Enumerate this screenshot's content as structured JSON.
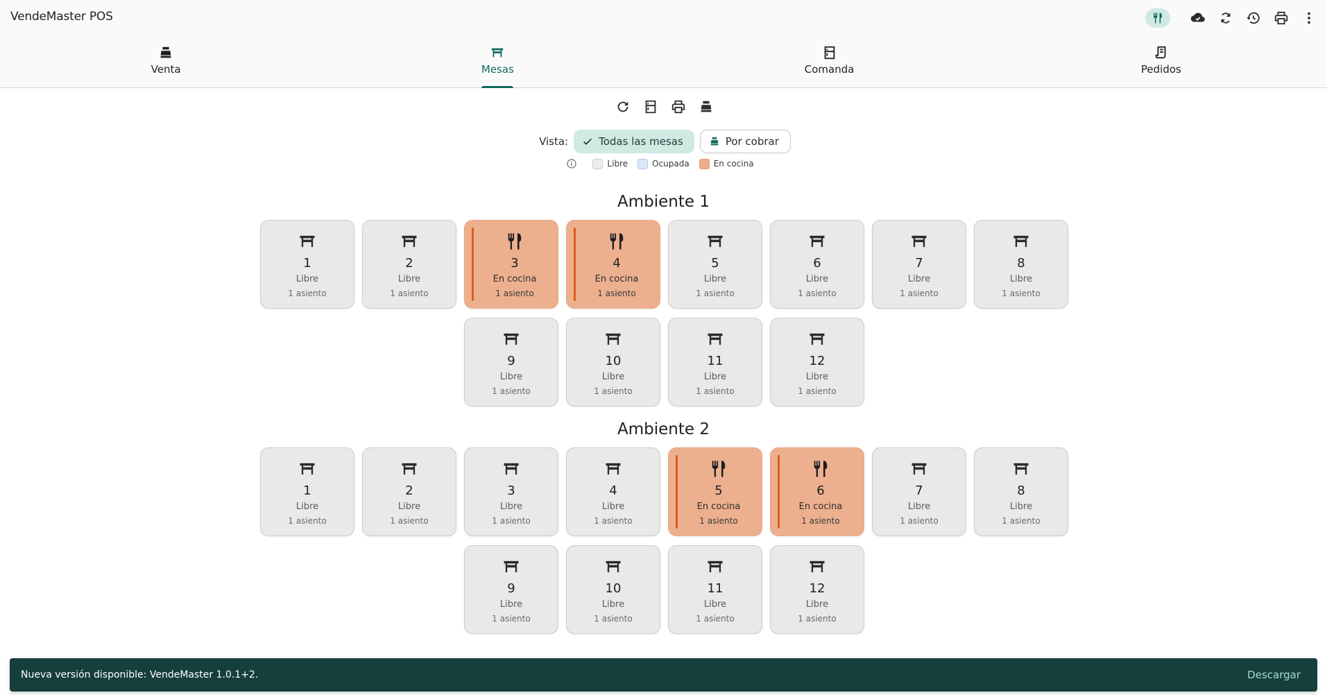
{
  "app": {
    "title": "VendeMaster POS"
  },
  "appbar": {
    "actions": [
      {
        "icon": "restaurant-icon"
      },
      {
        "icon": "cloud-done-icon"
      },
      {
        "icon": "sync-icon"
      },
      {
        "icon": "history-icon"
      },
      {
        "icon": "print-icon"
      },
      {
        "icon": "more-vert-icon"
      }
    ]
  },
  "tabs": [
    {
      "label": "Venta",
      "icon": "cash-register-icon",
      "active": false
    },
    {
      "label": "Mesas",
      "icon": "table-icon",
      "active": true
    },
    {
      "label": "Comanda",
      "icon": "kitchen-icon",
      "active": false
    },
    {
      "label": "Pedidos",
      "icon": "receipt-icon",
      "active": false
    }
  ],
  "toolbar": {
    "icons": [
      "refresh-icon",
      "kitchen-icon",
      "print-icon",
      "cash-register-icon"
    ]
  },
  "vista": {
    "label": "Vista:",
    "options": [
      {
        "label": "Todas las mesas",
        "selected": true
      },
      {
        "label": "Por cobrar",
        "selected": false
      }
    ]
  },
  "legend": {
    "items": [
      {
        "label": "Libre",
        "color": "#ececec"
      },
      {
        "label": "Ocupada",
        "color": "#dbe8f8"
      },
      {
        "label": "En cocina",
        "color": "#eeae8e"
      }
    ]
  },
  "colors": {
    "accent": "#11695b",
    "en_cocina": "#edb08f",
    "en_cocina_bar": "#e15a13",
    "libre": "#e9e9e9"
  },
  "areas": [
    {
      "title": "Ambiente 1",
      "tables": [
        {
          "num": "1",
          "state": "Libre",
          "seats": "1 asiento"
        },
        {
          "num": "2",
          "state": "Libre",
          "seats": "1 asiento"
        },
        {
          "num": "3",
          "state": "En cocina",
          "seats": "1 asiento"
        },
        {
          "num": "4",
          "state": "En cocina",
          "seats": "1 asiento"
        },
        {
          "num": "5",
          "state": "Libre",
          "seats": "1 asiento"
        },
        {
          "num": "6",
          "state": "Libre",
          "seats": "1 asiento"
        },
        {
          "num": "7",
          "state": "Libre",
          "seats": "1 asiento"
        },
        {
          "num": "8",
          "state": "Libre",
          "seats": "1 asiento"
        },
        {
          "num": "9",
          "state": "Libre",
          "seats": "1 asiento"
        },
        {
          "num": "10",
          "state": "Libre",
          "seats": "1 asiento"
        },
        {
          "num": "11",
          "state": "Libre",
          "seats": "1 asiento"
        },
        {
          "num": "12",
          "state": "Libre",
          "seats": "1 asiento"
        }
      ]
    },
    {
      "title": "Ambiente 2",
      "tables": [
        {
          "num": "1",
          "state": "Libre",
          "seats": "1 asiento"
        },
        {
          "num": "2",
          "state": "Libre",
          "seats": "1 asiento"
        },
        {
          "num": "3",
          "state": "Libre",
          "seats": "1 asiento"
        },
        {
          "num": "4",
          "state": "Libre",
          "seats": "1 asiento"
        },
        {
          "num": "5",
          "state": "En cocina",
          "seats": "1 asiento"
        },
        {
          "num": "6",
          "state": "En cocina",
          "seats": "1 asiento"
        },
        {
          "num": "7",
          "state": "Libre",
          "seats": "1 asiento"
        },
        {
          "num": "8",
          "state": "Libre",
          "seats": "1 asiento"
        },
        {
          "num": "9",
          "state": "Libre",
          "seats": "1 asiento"
        },
        {
          "num": "10",
          "state": "Libre",
          "seats": "1 asiento"
        },
        {
          "num": "11",
          "state": "Libre",
          "seats": "1 asiento"
        },
        {
          "num": "12",
          "state": "Libre",
          "seats": "1 asiento"
        }
      ]
    }
  ],
  "snackbar": {
    "message": "Nueva versión disponible: VendeMaster 1.0.1+2.",
    "action": "Descargar"
  }
}
